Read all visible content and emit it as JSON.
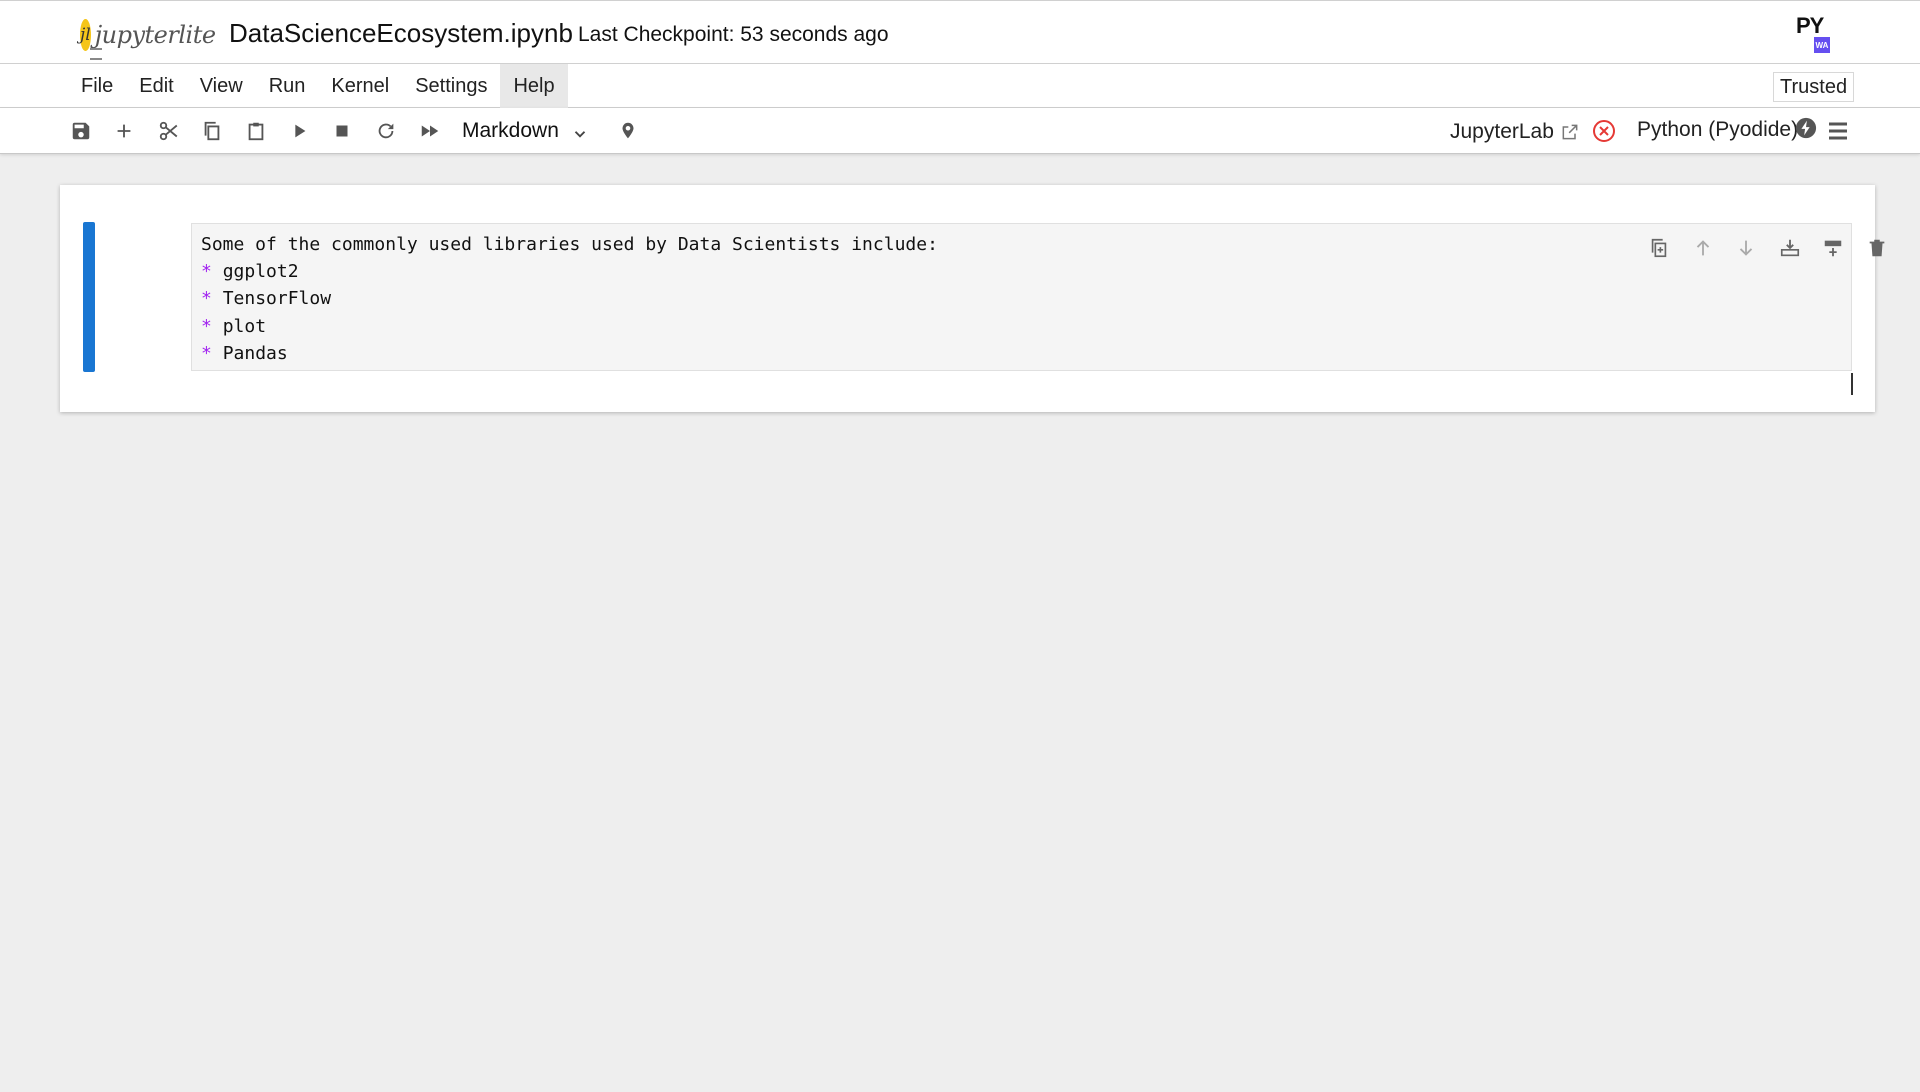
{
  "header": {
    "logo_text": "jupyterlite",
    "logo_mark": "jl",
    "notebook_title": "DataScienceEcosystem.ipynb",
    "checkpoint": "Last Checkpoint: 53 seconds ago",
    "badge_text": "PY",
    "badge_sub": "WA"
  },
  "menu": {
    "items": [
      "File",
      "Edit",
      "View",
      "Run",
      "Kernel",
      "Settings",
      "Help"
    ],
    "trusted": "Trusted"
  },
  "toolbar": {
    "icons": [
      "save-icon",
      "add-icon",
      "cut-icon",
      "copy-icon",
      "paste-icon",
      "run-icon",
      "stop-icon",
      "restart-icon",
      "fast-forward-icon"
    ],
    "cell_type": "Markdown",
    "jupyterlab_link": "JupyterLab",
    "kernel_name": "Python (Pyodide)"
  },
  "cell": {
    "lines": [
      {
        "bullet": "",
        "text": "Some of the commonly used libraries used by Data Scientists include:"
      },
      {
        "bullet": "*",
        "text": "ggplot2"
      },
      {
        "bullet": "*",
        "text": "TensorFlow"
      },
      {
        "bullet": "*",
        "text": "plot"
      },
      {
        "bullet": "*",
        "text": "Pandas"
      }
    ]
  },
  "colors": {
    "accent": "#1976d2",
    "markdown_bullet": "#a020f0",
    "kernel_error": "#e53935",
    "logo_yellow": "#f5c518"
  }
}
